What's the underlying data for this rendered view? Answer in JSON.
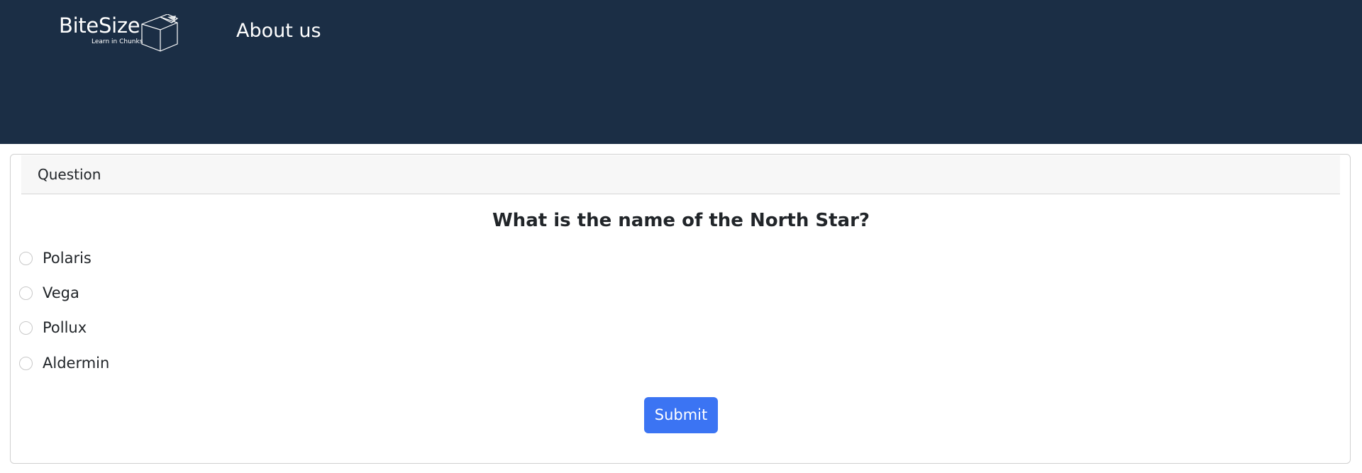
{
  "header": {
    "logo_title": "BiteSize",
    "logo_tagline": "Learn in Chunks",
    "nav_about": "About us",
    "background_color": "#1b2e45"
  },
  "card": {
    "header_label": "Question",
    "question": "What is the name of the North Star?",
    "options": [
      {
        "label": "Polaris",
        "selected": false
      },
      {
        "label": "Vega",
        "selected": false
      },
      {
        "label": "Pollux",
        "selected": false
      },
      {
        "label": "Aldermin",
        "selected": false
      }
    ],
    "submit_label": "Submit",
    "submit_color": "#3b74f3"
  }
}
